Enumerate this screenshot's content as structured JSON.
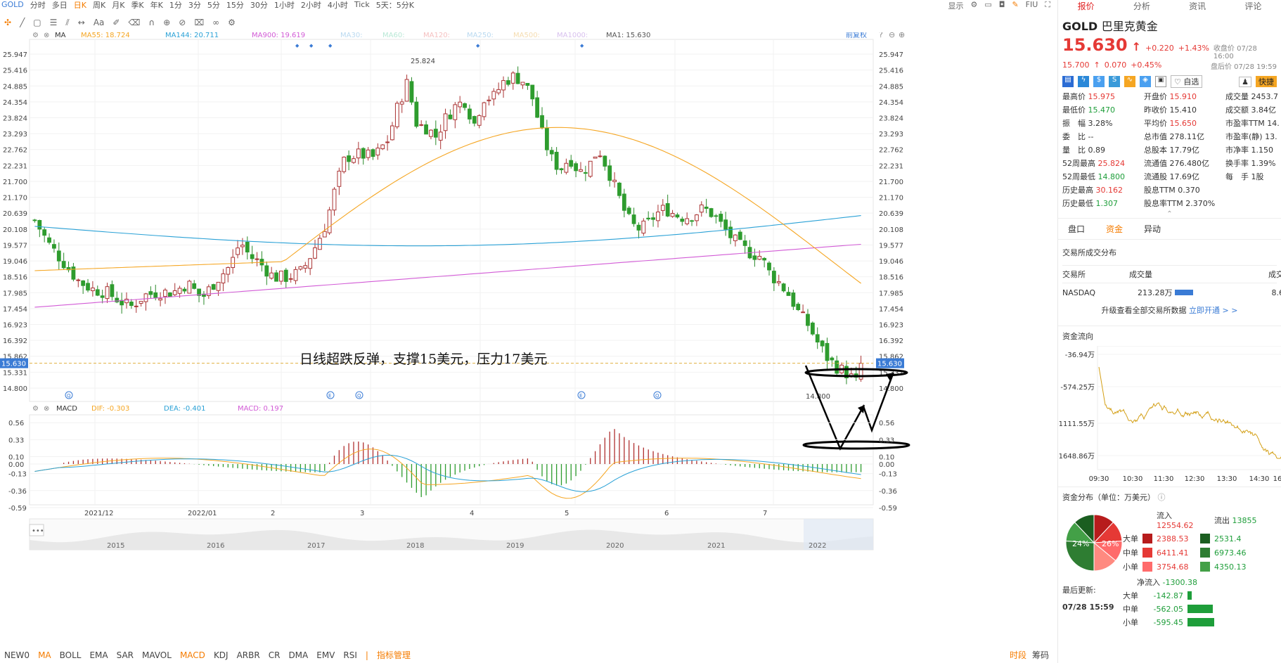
{
  "top": {
    "symbol": "GOLD",
    "periods": [
      "分时",
      "多日",
      "日K",
      "周K",
      "月K",
      "季K",
      "年K",
      "1分",
      "3分",
      "5分",
      "15分",
      "30分",
      "1小时",
      "2小时",
      "4小时",
      "Tick",
      "5天：5分K"
    ],
    "active": "日K",
    "right": [
      "显示",
      "FIU"
    ]
  },
  "toolbar": {
    "aa": "Aa"
  },
  "indicator_row": {
    "ma": "MA",
    "items": [
      {
        "t": "MA55: 18.724",
        "c": "#f5a623"
      },
      {
        "t": "MA144: 20.711",
        "c": "#2aa1d6"
      },
      {
        "t": "MA900: 19.619",
        "c": "#d25bd6"
      },
      {
        "t": "MA30:",
        "c": "#b9d9f0"
      },
      {
        "t": "MA60:",
        "c": "#b9e8d6"
      },
      {
        "t": "MA120:",
        "c": "#f5c0c0"
      },
      {
        "t": "MA250:",
        "c": "#b9d9f0"
      },
      {
        "t": "MA500:",
        "c": "#f5dcb0"
      },
      {
        "t": "MA1000:",
        "c": "#d8c0ee"
      },
      {
        "t": "MA1: 15.630",
        "c": "#555"
      }
    ],
    "restore": "前复权"
  },
  "price_axis": [
    "25.947",
    "25.416",
    "24.885",
    "24.354",
    "23.824",
    "23.293",
    "22.762",
    "22.231",
    "21.700",
    "21.170",
    "20.639",
    "20.108",
    "19.577",
    "19.046",
    "18.516",
    "17.985",
    "17.454",
    "16.923",
    "16.392",
    "15.862",
    "15.331",
    "14.800"
  ],
  "current_price": "15.630",
  "high_label": "25.824",
  "low_label": "14.800",
  "annotation": "日线超跌反弹，支撑15美元，压力17美元",
  "macd_row": {
    "name": "MACD",
    "dif": "DIF: -0.303",
    "dea": "DEA: -0.401",
    "macd": "MACD: 0.197"
  },
  "macd_axis": [
    "0.56",
    "0.33",
    "0.10",
    "0.00",
    "-0.13",
    "-0.36",
    "-0.59"
  ],
  "x_labels": [
    "2021/12",
    "2022/01",
    "2",
    "3",
    "4",
    "5",
    "6",
    "7"
  ],
  "overview_years": [
    "2015",
    "2016",
    "2017",
    "2018",
    "2019",
    "2020",
    "2021",
    "2022"
  ],
  "bottom": {
    "items": [
      "NEW0",
      "MA",
      "BOLL",
      "EMA",
      "SAR",
      "MAVOL",
      "MACD",
      "KDJ",
      "ARBR",
      "CR",
      "DMA",
      "EMV",
      "RSI"
    ],
    "active": [
      "MA",
      "MACD"
    ],
    "manage": "指标管理",
    "right": [
      "时段",
      "筹码"
    ]
  },
  "panel": {
    "tabs": [
      "报价",
      "分析",
      "资讯",
      "评论"
    ],
    "symbol": "GOLD",
    "name": "巴里克黄金",
    "price": "15.630",
    "change": "+0.220",
    "pct": "+1.43%",
    "close_label": "收盘价 07/28 16:00",
    "after": "15.700",
    "after_chg": "0.070",
    "after_pct": "+0.45%",
    "after_label": "盘后价 07/28 19:59",
    "watch": "自选",
    "quick": "快捷",
    "stats": [
      [
        "最高价",
        "15.975",
        "r"
      ],
      [
        "开盘价",
        "15.910",
        "r"
      ],
      [
        "成交量",
        "2453.7",
        ""
      ],
      [
        "最低价",
        "15.470",
        "g"
      ],
      [
        "昨收价",
        "15.410",
        ""
      ],
      [
        "成交额",
        "3.84亿",
        ""
      ],
      [
        "振　幅",
        "3.28%",
        ""
      ],
      [
        "平均价",
        "15.650",
        "r"
      ],
      [
        "市盈率TTM",
        "14.",
        ""
      ],
      [
        "委　比",
        "--",
        ""
      ],
      [
        "总市值",
        "278.11亿",
        ""
      ],
      [
        "市盈率(静)",
        "13.",
        ""
      ],
      [
        "量　比",
        "0.89",
        ""
      ],
      [
        "总股本",
        "17.79亿",
        ""
      ],
      [
        "市净率",
        "1.150",
        ""
      ],
      [
        "52周最高",
        "25.824",
        "r"
      ],
      [
        "流通值",
        "276.480亿",
        ""
      ],
      [
        "换手率",
        "1.39%",
        ""
      ],
      [
        "52周最低",
        "14.800",
        "g"
      ],
      [
        "流通股",
        "17.69亿",
        ""
      ],
      [
        "每　手",
        "1股",
        ""
      ],
      [
        "历史最高",
        "30.162",
        "r"
      ],
      [
        "股息TTM",
        "0.370",
        ""
      ],
      [
        "",
        "",
        " "
      ],
      [
        "历史最低",
        "1.307",
        "g"
      ],
      [
        "股息率TTM",
        "2.370%",
        ""
      ],
      [
        "",
        "",
        " "
      ]
    ],
    "subtabs": [
      "盘口",
      "资金",
      "异动"
    ],
    "dist_title": "交易所成交分布",
    "dist_head": [
      "交易所",
      "成交量",
      "成交"
    ],
    "dist_row": [
      "NASDAQ",
      "213.28万",
      "8.6"
    ],
    "upgrade": "升级查看全部交易所数据",
    "upgrade_link": "立即开通 > >",
    "flow_title": "资金流向",
    "flow_axis": [
      "-36.94万",
      "-574.25万",
      "-1111.55万",
      "-1648.86万"
    ],
    "flow_x": [
      "09:30",
      "10:30",
      "11:30",
      "12:30",
      "13:30",
      "14:30",
      "16"
    ],
    "capdist_title": "资金分布（单位：万美元）",
    "inflow": "流入",
    "inflow_v": "12554.62",
    "outflow": "流出",
    "outflow_v": "13855",
    "rows": [
      [
        "大单",
        "2388.53",
        "2531.4"
      ],
      [
        "中单",
        "6411.41",
        "6973.46"
      ],
      [
        "小单",
        "3754.68",
        "4350.13"
      ]
    ],
    "pie": [
      {
        "label": "24%",
        "v": 24
      },
      {
        "label": "26%",
        "v": 26
      }
    ],
    "net_title": "净流入",
    "net_v": "-1300.38",
    "net_rows": [
      [
        "大单",
        "-142.87"
      ],
      [
        "中单",
        "-562.05"
      ],
      [
        "小单",
        "-595.45"
      ]
    ],
    "updated_label": "最后更新:",
    "updated": "07/28 15:59"
  }
}
